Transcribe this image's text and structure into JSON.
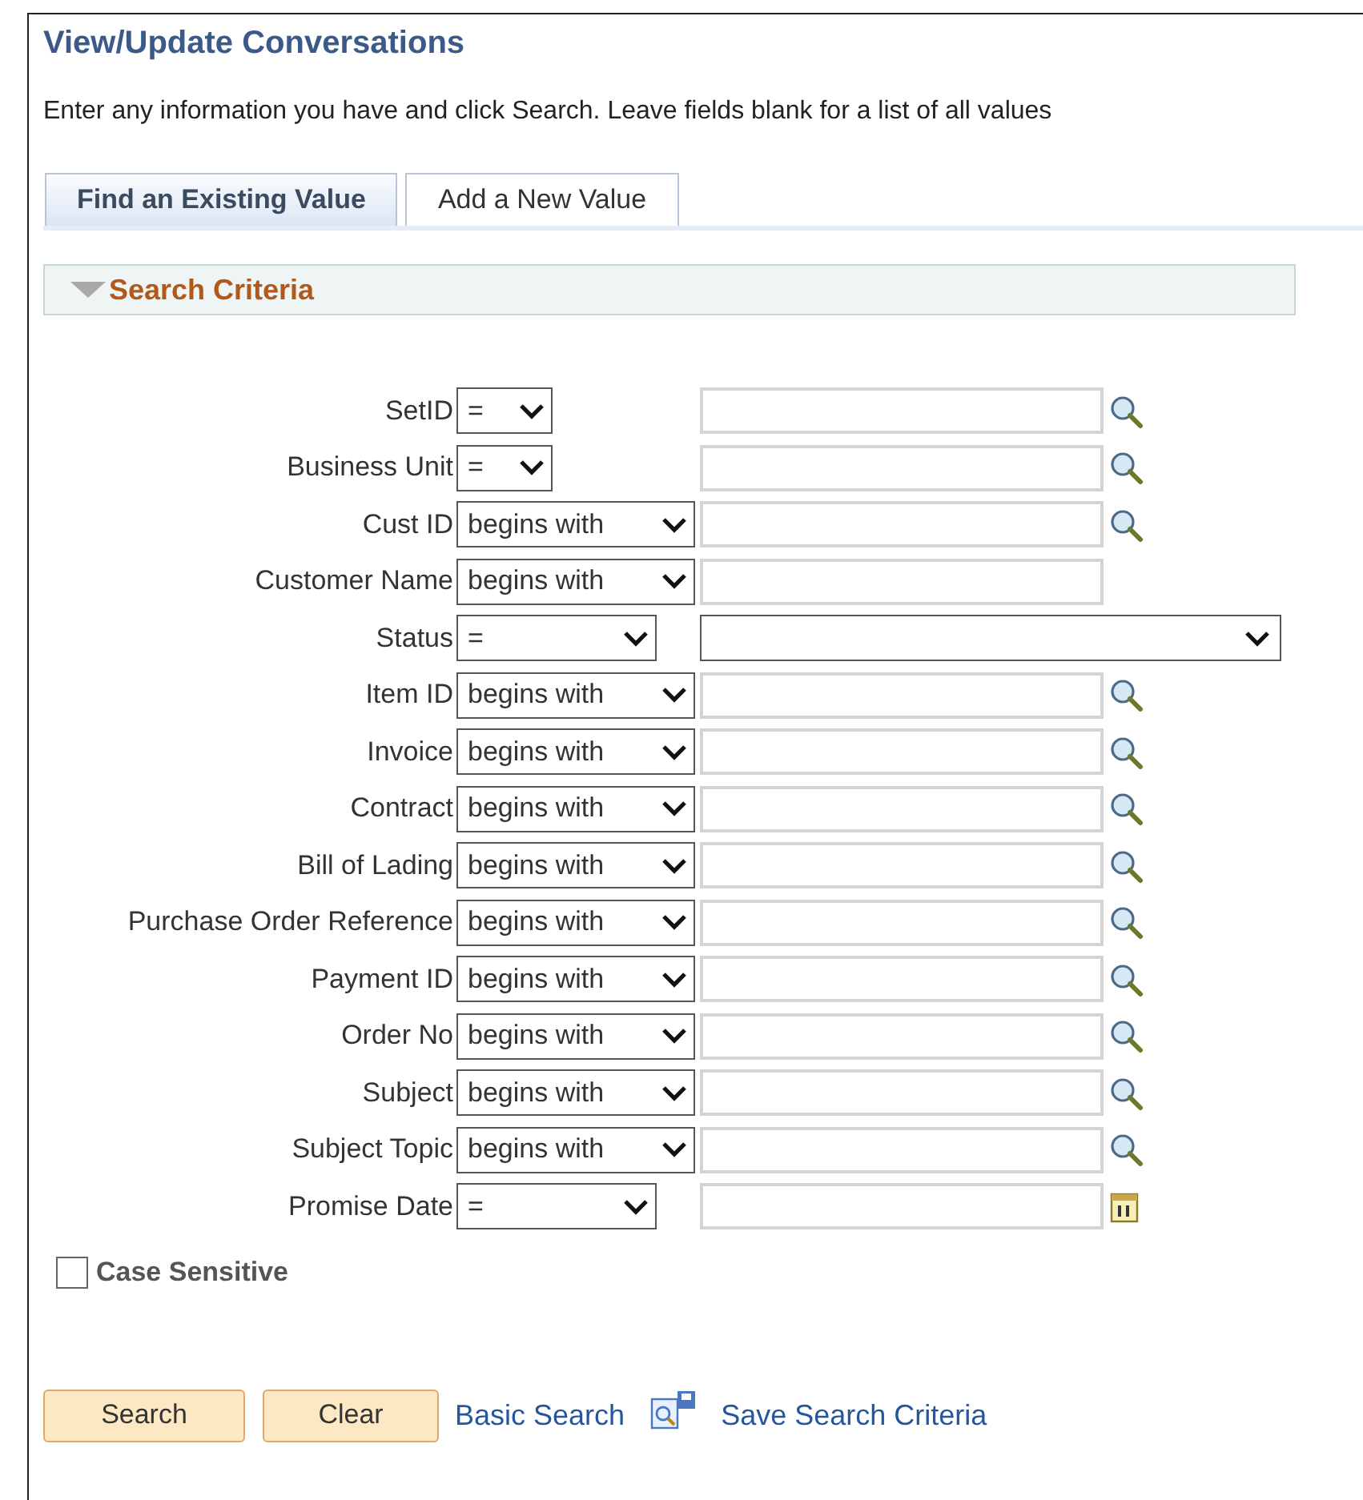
{
  "page": {
    "title": "View/Update Conversations",
    "instructions": "Enter any information you have and click Search. Leave fields blank for a list of all values"
  },
  "tabs": [
    {
      "label": "Find an Existing Value",
      "selected": true
    },
    {
      "label": "Add a New Value",
      "selected": false
    }
  ],
  "section": {
    "title": "Search Criteria",
    "expanded": true
  },
  "criteria": [
    {
      "label": "SetID",
      "operator": "=",
      "kind": "lookup"
    },
    {
      "label": "Business Unit",
      "operator": "=",
      "kind": "lookup"
    },
    {
      "label": "Cust ID",
      "operator": "begins with",
      "kind": "lookup"
    },
    {
      "label": "Customer Name",
      "operator": "begins with",
      "kind": "text"
    },
    {
      "label": "Status",
      "operator": "=",
      "kind": "dropdown"
    },
    {
      "label": "Item ID",
      "operator": "begins with",
      "kind": "lookup"
    },
    {
      "label": "Invoice",
      "operator": "begins with",
      "kind": "lookup"
    },
    {
      "label": "Contract",
      "operator": "begins with",
      "kind": "lookup"
    },
    {
      "label": "Bill of Lading",
      "operator": "begins with",
      "kind": "lookup"
    },
    {
      "label": "Purchase Order Reference",
      "operator": "begins with",
      "kind": "lookup"
    },
    {
      "label": "Payment ID",
      "operator": "begins with",
      "kind": "lookup"
    },
    {
      "label": "Order No",
      "operator": "begins with",
      "kind": "lookup"
    },
    {
      "label": "Subject",
      "operator": "begins with",
      "kind": "lookup"
    },
    {
      "label": "Subject Topic",
      "operator": "begins with",
      "kind": "lookup"
    },
    {
      "label": "Promise Date",
      "operator": "=",
      "kind": "date"
    }
  ],
  "case_sensitive": {
    "label": "Case Sensitive",
    "checked": false
  },
  "buttons": [
    "Search",
    "Clear"
  ],
  "links": [
    "Basic Search",
    "Save Search Criteria"
  ]
}
